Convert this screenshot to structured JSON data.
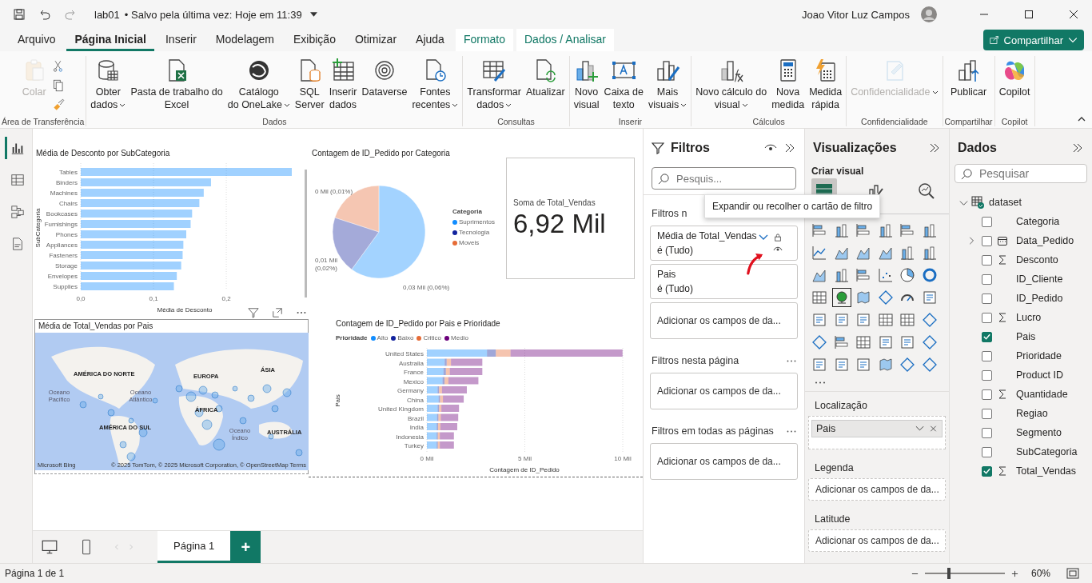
{
  "title_bar": {
    "file": "lab01",
    "save_status": "• Salvo pela última vez: Hoje em 11:39",
    "user": "Joao Vitor Luz Campos"
  },
  "menu_tabs": [
    {
      "label": "Arquivo",
      "selected": false,
      "kind": "plain"
    },
    {
      "label": "Página Inicial",
      "selected": true,
      "kind": "plain"
    },
    {
      "label": "Inserir",
      "selected": false,
      "kind": "plain"
    },
    {
      "label": "Modelagem",
      "selected": false,
      "kind": "plain"
    },
    {
      "label": "Exibição",
      "selected": false,
      "kind": "plain"
    },
    {
      "label": "Otimizar",
      "selected": false,
      "kind": "plain"
    },
    {
      "label": "Ajuda",
      "selected": false,
      "kind": "plain"
    },
    {
      "label": "Formato",
      "selected": false,
      "kind": "context"
    },
    {
      "label": "Dados / Analisar",
      "selected": false,
      "kind": "context"
    }
  ],
  "share_button": "Compartilhar",
  "ribbon_groups": [
    {
      "name": "Área de Transferência",
      "buttons": [
        {
          "kind": "large",
          "lines": [
            "Colar"
          ],
          "caret": false,
          "disabled": true
        },
        {
          "kind": "small",
          "disabled": false
        },
        {
          "kind": "small",
          "disabled": false
        },
        {
          "kind": "small",
          "disabled": false
        }
      ]
    },
    {
      "name": "Dados",
      "buttons": [
        {
          "kind": "large",
          "lines": [
            "Obter",
            "dados"
          ],
          "caret": true,
          "disabled": false
        },
        {
          "kind": "large",
          "lines": [
            "Pasta de trabalho do",
            "Excel"
          ],
          "caret": false,
          "disabled": false
        },
        {
          "kind": "large",
          "lines": [
            "Catálogo",
            "do OneLake"
          ],
          "caret": true,
          "disabled": false
        },
        {
          "kind": "large",
          "lines": [
            "SQL",
            "Server"
          ],
          "caret": false,
          "disabled": false
        },
        {
          "kind": "large",
          "lines": [
            "Inserir",
            "dados"
          ],
          "caret": false,
          "disabled": false
        },
        {
          "kind": "large",
          "lines": [
            "Dataverse"
          ],
          "caret": false,
          "disabled": false
        },
        {
          "kind": "large",
          "lines": [
            "Fontes",
            "recentes"
          ],
          "caret": true,
          "disabled": false
        }
      ]
    },
    {
      "name": "Consultas",
      "buttons": [
        {
          "kind": "large",
          "lines": [
            "Transformar",
            "dados"
          ],
          "caret": true,
          "disabled": false
        },
        {
          "kind": "large",
          "lines": [
            "Atualizar"
          ],
          "caret": false,
          "disabled": false
        }
      ]
    },
    {
      "name": "Inserir",
      "buttons": [
        {
          "kind": "large",
          "lines": [
            "Novo",
            "visual"
          ],
          "caret": false,
          "disabled": false
        },
        {
          "kind": "large",
          "lines": [
            "Caixa de",
            "texto"
          ],
          "caret": false,
          "disabled": false
        },
        {
          "kind": "large",
          "lines": [
            "Mais",
            "visuais"
          ],
          "caret": true,
          "disabled": false
        }
      ]
    },
    {
      "name": "Cálculos",
      "buttons": [
        {
          "kind": "large",
          "lines": [
            "Novo cálculo do",
            "visual"
          ],
          "caret": true,
          "disabled": false
        },
        {
          "kind": "large",
          "lines": [
            "Nova",
            "medida"
          ],
          "caret": false,
          "disabled": false
        },
        {
          "kind": "large",
          "lines": [
            "Medida",
            "rápida"
          ],
          "caret": false,
          "disabled": false
        }
      ]
    },
    {
      "name": "Confidencialidade",
      "buttons": [
        {
          "kind": "large",
          "lines": [
            "Confidencialidade"
          ],
          "caret": true,
          "disabled": true
        }
      ]
    },
    {
      "name": "Compartilhar",
      "buttons": [
        {
          "kind": "large",
          "lines": [
            "Publicar"
          ],
          "caret": false,
          "disabled": false
        }
      ]
    },
    {
      "name": "Copilot",
      "buttons": [
        {
          "kind": "large",
          "lines": [
            "Copilot"
          ],
          "caret": false,
          "disabled": false
        }
      ]
    }
  ],
  "left_nav": [
    {
      "selected": true
    },
    {
      "selected": false
    },
    {
      "selected": false
    },
    {
      "selected": false
    }
  ],
  "report": {
    "bar_chart": {
      "title": "Média de Desconto por SubCategoria",
      "chart_data": {
        "type": "bar",
        "orientation": "horizontal",
        "xlabel": "Média de Desconto",
        "ylabel": "SubCategoria",
        "categories": [
          "Tables",
          "Binders",
          "Machines",
          "Chairs",
          "Bookcases",
          "Furnishings",
          "Phones",
          "Appliances",
          "Fasteners",
          "Storage",
          "Envelopes",
          "Supplies"
        ],
        "xlim": [
          0,
          0.29
        ],
        "xticks": [
          {
            "value": 0,
            "label": "0,0"
          },
          {
            "value": 0.1,
            "label": "0,1"
          },
          {
            "value": 0.2,
            "label": "0,2"
          }
        ],
        "series": [
          {
            "color": "#118dff",
            "values": [
              0.29,
              0.179,
              0.169,
              0.163,
              0.153,
              0.151,
              0.145,
              0.141,
              0.14,
              0.138,
              0.132,
              0.128
            ]
          }
        ]
      }
    },
    "pie_chart": {
      "title": "Contagem de ID_Pedido por Categoria",
      "legend_title": "Categoria",
      "chart_data": {
        "type": "pie",
        "categories": [
          "Suprimentos",
          "Tecnologia",
          "Moveis"
        ],
        "values": [
          0.03,
          0.01,
          0.01
        ],
        "colors": [
          "#118dff",
          "#12239e",
          "#e66c37"
        ],
        "value_labels": [
          "0,03 Mil (0,06%)",
          "0,01 Mil (0,02%)",
          "0 Mil (0,01%)"
        ]
      }
    },
    "card": {
      "label": "Soma de Total_Vendas",
      "value": "6,92 Mil"
    },
    "map": {
      "title": "Média de Total_Vendas por Pais",
      "labels": [
        {
          "text": "AMÉRICA DO NORTE",
          "kind": "continent"
        },
        {
          "text": "EUROPA",
          "kind": "continent"
        },
        {
          "text": "ÁSIA",
          "kind": "continent"
        },
        {
          "text": "Oceano Pacífico",
          "kind": "ocean"
        },
        {
          "text": "Oceano Atlântico",
          "kind": "ocean"
        },
        {
          "text": "ÁFRICA",
          "kind": "continent"
        },
        {
          "text": "AMÉRICA DO SUL",
          "kind": "continent"
        },
        {
          "text": "Oceano Índico",
          "kind": "ocean"
        },
        {
          "text": "AUSTRÁLIA",
          "kind": "continent"
        }
      ],
      "brand": "Microsoft Bing",
      "attribution": "© 2025 TomTom, © 2025 Microsoft Corporation, © OpenStreetMap Terms"
    },
    "stacked_chart": {
      "title": "Contagem de ID_Pedido por Pais e Prioridade",
      "legend_title": "Prioridade",
      "chart_data": {
        "type": "bar",
        "orientation": "horizontal",
        "stacked": true,
        "xlabel": "Contagem de ID_Pedido",
        "ylabel": "Pais",
        "categories": [
          "United States",
          "Australia",
          "France",
          "Mexico",
          "Germany",
          "China",
          "United Kingdom",
          "Brazil",
          "India",
          "Indonesia",
          "Turkey"
        ],
        "xlim": [
          0,
          10
        ],
        "xticks": [
          {
            "value": 0,
            "label": "0 Mil"
          },
          {
            "value": 5,
            "label": "5 Mil"
          },
          {
            "value": 10,
            "label": "10 Mil"
          }
        ],
        "series": [
          {
            "name": "Alto",
            "color": "#118dff",
            "values": [
              3.07,
              0.91,
              0.85,
              0.8,
              0.55,
              0.6,
              0.55,
              0.52,
              0.5,
              0.5,
              0.5
            ]
          },
          {
            "name": "Baixo",
            "color": "#12239e",
            "values": [
              0.45,
              0.1,
              0.12,
              0.1,
              0.07,
              0.07,
              0.07,
              0.07,
              0.07,
              0.06,
              0.06
            ]
          },
          {
            "name": "Critico",
            "color": "#e66c37",
            "values": [
              0.75,
              0.22,
              0.2,
              0.2,
              0.15,
              0.15,
              0.12,
              0.12,
              0.12,
              0.1,
              0.1
            ]
          },
          {
            "name": "Medio",
            "color": "#6b007b",
            "values": [
              5.72,
              1.6,
              1.66,
              1.53,
              1.27,
              1.06,
              0.9,
              0.89,
              0.86,
              0.72,
              0.72
            ]
          }
        ]
      }
    }
  },
  "page_tabs": [
    {
      "label": "Página 1",
      "selected": true
    }
  ],
  "add_page": "+",
  "filters": {
    "title": "Filtros",
    "search": {
      "placeholder": "Pesquis..."
    },
    "tooltip": "Expandir ou recolher o cartão de filtro",
    "sections": [
      {
        "title": "Filtros n",
        "more": false,
        "cards": [
          {
            "kind": "filter",
            "field": "Média de Total_Vendas",
            "condition": "é (Tudo)",
            "hovered": true
          },
          {
            "kind": "filter",
            "field": "Pais",
            "condition": "é (Tudo)",
            "hovered": false
          },
          {
            "kind": "add",
            "text": "Adicionar os campos de da..."
          }
        ]
      },
      {
        "title": "Filtros nesta página",
        "more": true,
        "cards": [
          {
            "kind": "add",
            "text": "Adicionar os campos de da..."
          }
        ]
      },
      {
        "title": "Filtros em todas as páginas",
        "more": true,
        "cards": [
          {
            "kind": "add",
            "text": "Adicionar os campos de da..."
          }
        ]
      }
    ]
  },
  "visualizations": {
    "title": "Visualizações",
    "subtitle": "Criar visual",
    "modes": [
      {
        "selected": true
      },
      {
        "selected": false
      },
      {
        "selected": false
      }
    ],
    "visual_types": [
      {
        "selected": false
      },
      {
        "selected": false
      },
      {
        "selected": false
      },
      {
        "selected": false
      },
      {
        "selected": false
      },
      {
        "selected": false
      },
      {
        "selected": false
      },
      {
        "selected": false
      },
      {
        "selected": false
      },
      {
        "selected": false
      },
      {
        "selected": false
      },
      {
        "selected": false
      },
      {
        "selected": false
      },
      {
        "selected": false
      },
      {
        "selected": false
      },
      {
        "selected": false
      },
      {
        "selected": false
      },
      {
        "selected": false
      },
      {
        "selected": false
      },
      {
        "selected": true
      },
      {
        "selected": false
      },
      {
        "selected": false
      },
      {
        "selected": false
      },
      {
        "selected": false
      },
      {
        "selected": false
      },
      {
        "selected": false
      },
      {
        "selected": false
      },
      {
        "selected": false
      },
      {
        "selected": false
      },
      {
        "selected": false
      },
      {
        "selected": false
      },
      {
        "selected": false
      },
      {
        "selected": false
      },
      {
        "selected": false
      },
      {
        "selected": false
      },
      {
        "selected": false
      },
      {
        "selected": false
      },
      {
        "selected": false
      },
      {
        "selected": false
      },
      {
        "selected": false
      },
      {
        "selected": false
      },
      {
        "selected": false
      }
    ],
    "wells": [
      {
        "label": "Localização",
        "kind": "filled",
        "value": "Pais"
      },
      {
        "label": "Legenda",
        "kind": "empty",
        "value": "Adicionar os campos de da..."
      },
      {
        "label": "Latitude",
        "kind": "empty",
        "value": "Adicionar os campos de da..."
      }
    ]
  },
  "data": {
    "title": "Dados",
    "search": {
      "placeholder": "Pesquisar"
    },
    "tree": [
      {
        "label": "dataset",
        "expanded": true,
        "children": [
          {
            "label": "Categoria",
            "checked": false,
            "kind": "text"
          },
          {
            "label": "Data_Pedido",
            "checked": false,
            "kind": "date",
            "expanded": false
          },
          {
            "label": "Desconto",
            "checked": false,
            "kind": "sum"
          },
          {
            "label": "ID_Cliente",
            "checked": false,
            "kind": "text"
          },
          {
            "label": "ID_Pedido",
            "checked": false,
            "kind": "text"
          },
          {
            "label": "Lucro",
            "checked": false,
            "kind": "sum"
          },
          {
            "label": "Pais",
            "checked": true,
            "kind": "text"
          },
          {
            "label": "Prioridade",
            "checked": false,
            "kind": "text"
          },
          {
            "label": "Product ID",
            "checked": false,
            "kind": "text"
          },
          {
            "label": "Quantidade",
            "checked": false,
            "kind": "sum"
          },
          {
            "label": "Regiao",
            "checked": false,
            "kind": "text"
          },
          {
            "label": "Segmento",
            "checked": false,
            "kind": "text"
          },
          {
            "label": "SubCategoria",
            "checked": false,
            "kind": "text"
          },
          {
            "label": "Total_Vendas",
            "checked": true,
            "kind": "sum"
          }
        ]
      }
    ]
  },
  "status_bar": {
    "page": "Página 1 de 1",
    "zoom": {
      "level": 0.3,
      "reading": "60%"
    }
  }
}
